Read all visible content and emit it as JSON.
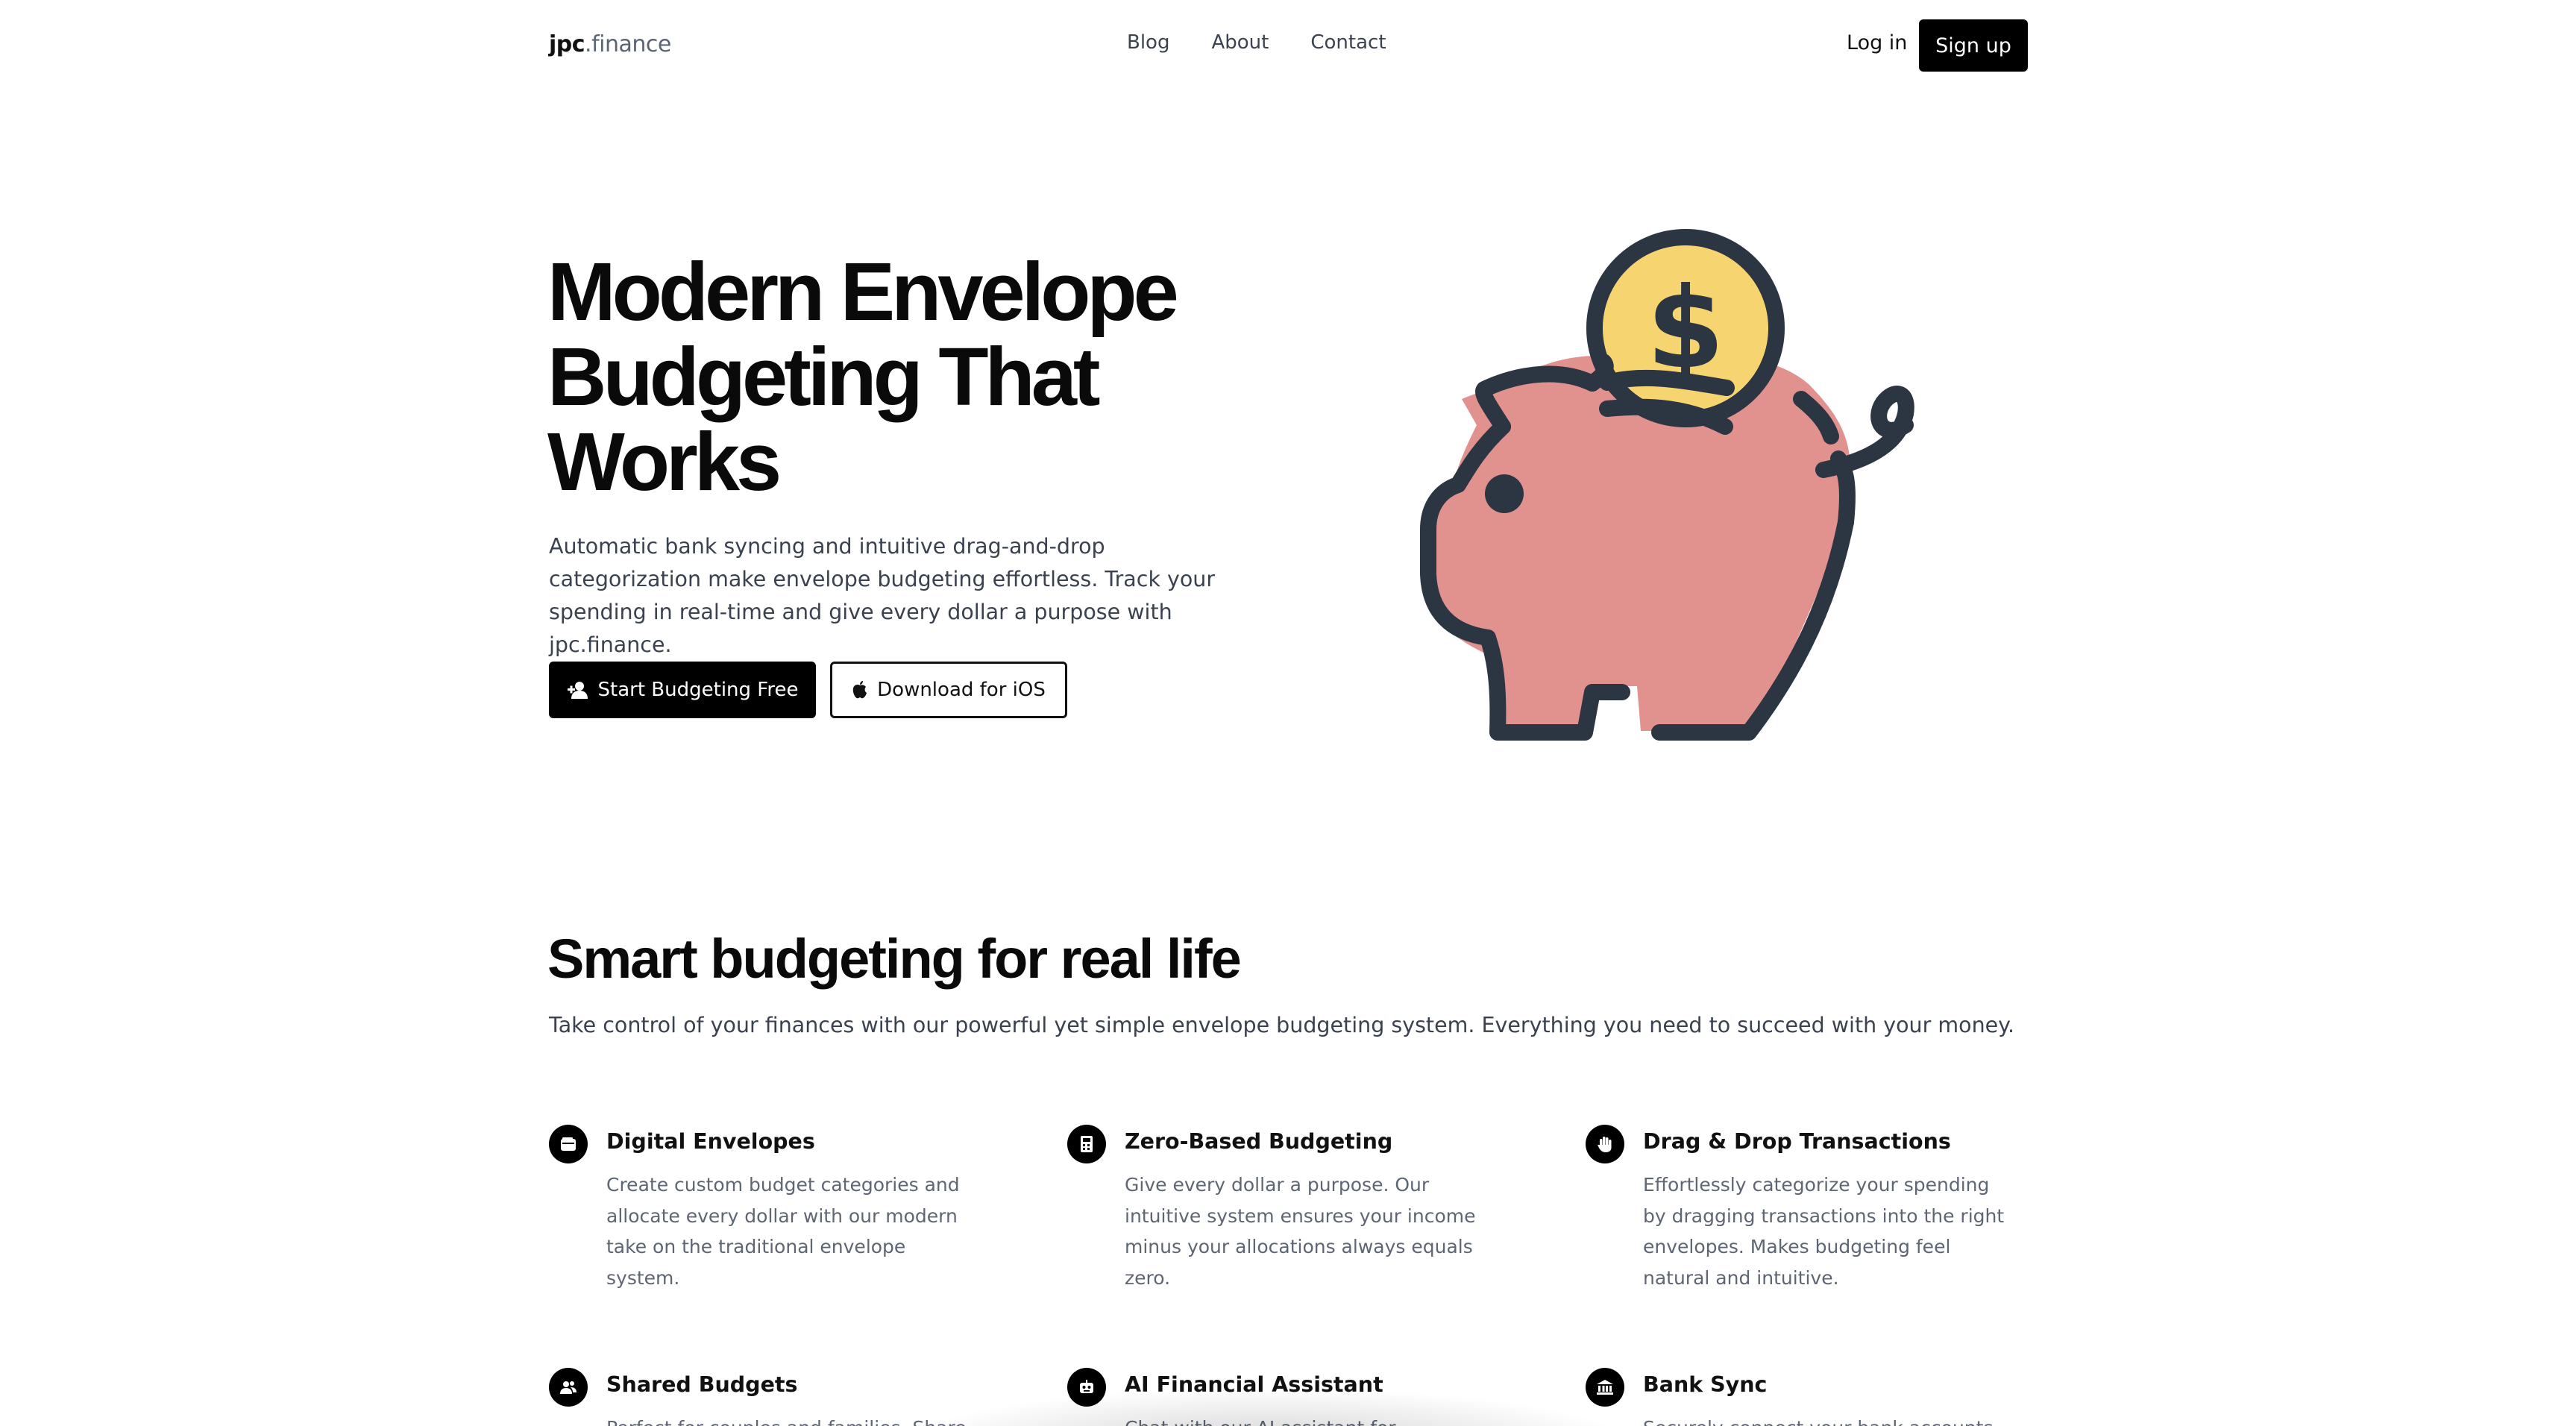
{
  "brand": {
    "name_bold": "jpc",
    "name_light": ".finance"
  },
  "nav": {
    "links": [
      "Blog",
      "About",
      "Contact"
    ],
    "login": "Log in",
    "signup": "Sign up"
  },
  "hero": {
    "title_lines": [
      "Modern Envelope",
      "Budgeting That",
      "Works"
    ],
    "subtitle": "Automatic bank syncing and intuitive drag-and-drop categorization make envelope budgeting effortless. Track your spending in real-time and give every dollar a purpose with jpc.finance.",
    "primary_cta": "Start Budgeting Free",
    "secondary_cta": "Download for iOS",
    "illustration": "piggy-bank-with-dollar-coin"
  },
  "features": {
    "title": "Smart budgeting for real life",
    "subtitle": "Take control of your finances with our powerful yet simple envelope budgeting system. Everything you need to succeed with your money.",
    "items": [
      {
        "icon": "wallet-icon",
        "title": "Digital Envelopes",
        "description": "Create custom budget categories and allocate every dollar with our modern take on the traditional envelope system."
      },
      {
        "icon": "calculator-icon",
        "title": "Zero-Based Budgeting",
        "description": "Give every dollar a purpose. Our intuitive system ensures your income minus your allocations always equals zero."
      },
      {
        "icon": "hand-icon",
        "title": "Drag & Drop Transactions",
        "description": "Effortlessly categorize your spending by dragging transactions into the right envelopes. Makes budgeting feel natural and intuitive."
      },
      {
        "icon": "users-icon",
        "title": "Shared Budgets",
        "description": "Perfect for couples and families. Share"
      },
      {
        "icon": "robot-icon",
        "title": "AI Financial Assistant",
        "description": "Chat with our AI assistant for personalized"
      },
      {
        "icon": "bank-icon",
        "title": "Bank Sync",
        "description": "Securely connect your bank accounts for"
      }
    ]
  },
  "colors": {
    "accent": "#000000",
    "piggy_pink": "#e2928e",
    "coin_yellow": "#f6d46f",
    "outline": "#2c3542"
  }
}
